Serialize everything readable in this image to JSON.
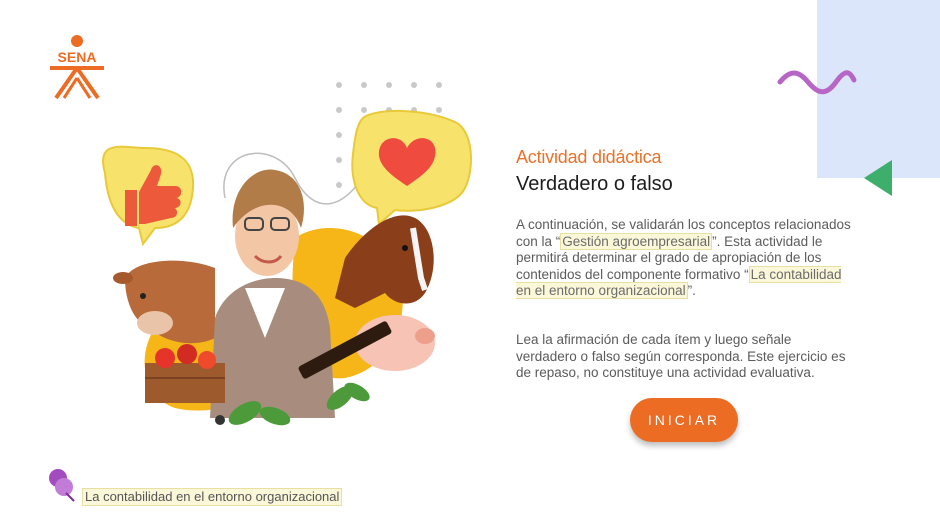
{
  "logo": {
    "text": "SENA"
  },
  "content": {
    "activity_label": "Actividad didáctica",
    "title": "Verdadero o falso",
    "intro": {
      "part1": "A continuación, se validarán los conceptos relacionados con la “",
      "highlight1": "Gestión agroempresarial",
      "part2": "”.  Esta actividad le permitirá determinar el grado de apropiación de los contenidos del componente formativo “",
      "highlight2": "La contabilidad en el entorno organizacional",
      "part3": "”."
    },
    "instructions": "Lea la afirmación de cada ítem y luego señale verdadero o falso según corresponda.  Este ejercicio es de repaso, no constituye una actividad evaluativa.",
    "start_button": "INICIAR"
  },
  "footer": {
    "label": "La contabilidad en el entorno organizacional"
  },
  "colors": {
    "accent_orange": "#ec6c24",
    "panel_blue": "#dce6fb",
    "squiggle_purple": "#b866c6",
    "triangle_green": "#3dae6b",
    "highlight_bg": "#fbf7d9"
  },
  "icons": [
    "sena-logo",
    "thumbs-up-icon",
    "heart-icon",
    "squiggle-decoration",
    "triangle-decoration",
    "pin-icon"
  ]
}
